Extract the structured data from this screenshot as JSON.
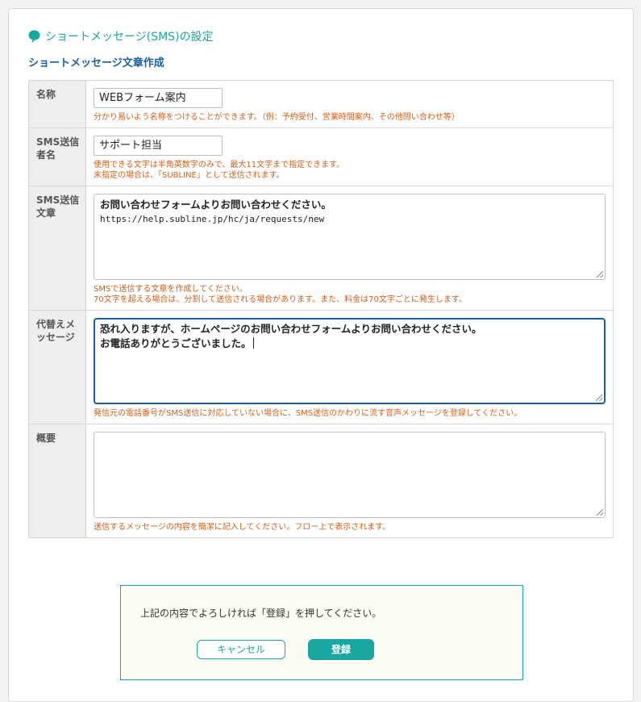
{
  "page": {
    "title": "ショートメッセージ(SMS)の設定",
    "section_title": "ショートメッセージ文章作成",
    "accent_color": "#1aa7a2",
    "heading_color": "#1d5f9e",
    "hint_color": "#d4601b"
  },
  "form": {
    "name": {
      "label": "名称",
      "value": "WEBフォーム案内",
      "hint": "分かり易いよう名称をつけることができます。（例：予約受付、営業時間案内、その他問い合わせ等）"
    },
    "sender": {
      "label": "SMS送信者名",
      "value": "サポート担当",
      "hint_1": "使用できる文字は半角英数字のみで、最大11文字まで指定できます。",
      "hint_2": "未指定の場合は、「SUBLINE」として送信されます。"
    },
    "sms_text": {
      "label": "SMS送信文章",
      "line_1": "お問い合わせフォームよりお問い合わせください。",
      "line_2": "https://help.subline.jp/hc/ja/requests/new",
      "hint_1": "SMSで送信する文章を作成してください。",
      "hint_2": "70文字を超える場合は、分割して送信される場合があります。また、料金は70文字ごとに発生します。"
    },
    "alt_message": {
      "label": "代替えメッセージ",
      "line_1": "恐れ入りますが、ホームページのお問い合わせフォームよりお問い合わせください。",
      "line_2": "お電話ありがとうございました。",
      "hint": "発信元の電話番号がSMS送信に対応していない場合に、SMS送信のかわりに流す音声メッセージを登録してください。"
    },
    "summary": {
      "label": "概要",
      "value": "",
      "hint": "送信するメッセージの内容を簡潔に記入してください。フロー上で表示されます。"
    }
  },
  "confirm": {
    "text": "上記の内容でよろしければ「登録」を押してください。",
    "cancel_label": "キャンセル",
    "register_label": "登録"
  }
}
